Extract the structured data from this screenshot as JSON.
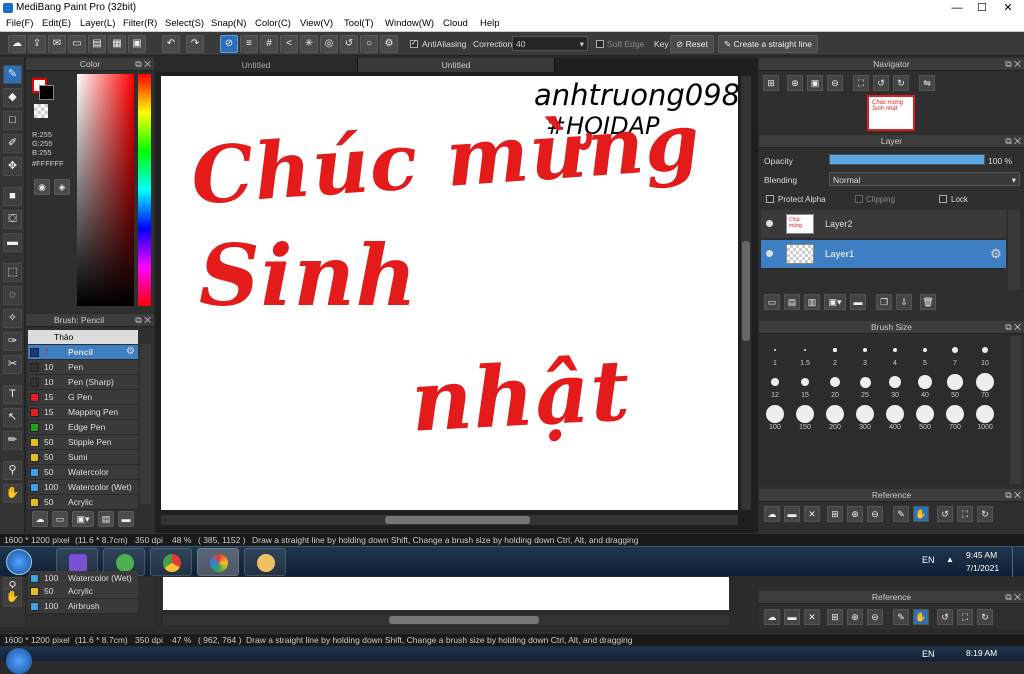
{
  "window": {
    "title": "MediBang Paint Pro (32bit)",
    "minimize": "—",
    "maximize": "☐",
    "close": "✕"
  },
  "menu": [
    "File(F)",
    "Edit(E)",
    "Layer(L)",
    "Filter(R)",
    "Select(S)",
    "Snap(N)",
    "Color(C)",
    "View(V)",
    "Tool(T)",
    "Window(W)",
    "Cloud",
    "Help"
  ],
  "toolbar": {
    "antialiasing": "AntiAliasing",
    "correction_label": "Correction",
    "correction_value": "40",
    "soft_edge": "Soft Edge",
    "key_label": "Key",
    "reset": "Reset",
    "straight_line": "Create a straight line"
  },
  "color_panel": {
    "title": "Color",
    "r": "R:255",
    "g": "G:255",
    "b": "B:255",
    "hex": "#FFFFFF"
  },
  "brush_panel": {
    "title": "Brush: Pencil",
    "group": "Thảo",
    "items": [
      {
        "size": "7",
        "name": "Pencil",
        "color": "#1a3a80"
      },
      {
        "size": "10",
        "name": "Pen",
        "color": "#333333"
      },
      {
        "size": "10",
        "name": "Pen (Sharp)",
        "color": "#333333"
      },
      {
        "size": "15",
        "name": "G Pen",
        "color": "#e02020"
      },
      {
        "size": "15",
        "name": "Mapping Pen",
        "color": "#e02020"
      },
      {
        "size": "10",
        "name": "Edge Pen",
        "color": "#20a020"
      },
      {
        "size": "50",
        "name": "Stipple Pen",
        "color": "#e0c020"
      },
      {
        "size": "50",
        "name": "Sumi",
        "color": "#e0c020"
      },
      {
        "size": "50",
        "name": "Watercolor",
        "color": "#40a0e0"
      },
      {
        "size": "100",
        "name": "Watercolor (Wet)",
        "color": "#40a0e0"
      },
      {
        "size": "50",
        "name": "Acrylic",
        "color": "#e0c020"
      }
    ]
  },
  "tabs": [
    "Untitled",
    "Untitled"
  ],
  "artwork": {
    "line1": "Chúc mừng",
    "line2": "Sinh",
    "line3": "nhật",
    "sig1": "anhtruong098",
    "sig2": "#HOIDAP"
  },
  "navigator": {
    "title": "Navigator"
  },
  "layer_panel": {
    "title": "Layer",
    "opacity_label": "Opacity",
    "opacity_value": "100 %",
    "opacity": 1.0,
    "blending_label": "Blending",
    "blending_value": "Normal",
    "protect_alpha": "Protect Alpha",
    "clipping": "Clipping",
    "lock": "Lock",
    "layers": [
      "Layer2",
      "Layer1"
    ]
  },
  "brush_size": {
    "title": "Brush Size",
    "sizes": [
      "1",
      "1.5",
      "2",
      "3",
      "4",
      "5",
      "7",
      "10",
      "12",
      "15",
      "20",
      "25",
      "30",
      "40",
      "50",
      "70",
      "100",
      "150",
      "200",
      "300",
      "400",
      "500",
      "700",
      "1000"
    ]
  },
  "reference": {
    "title": "Reference"
  },
  "status": {
    "dimensions": "1600 * 1200 pixel",
    "physical": "(11.6 * 8.7cm)",
    "dpi": "350 dpi",
    "zoom": "48 %",
    "coords": "( 385, 1152 )",
    "hint": "Draw a straight line by holding down Shift, Change a brush size by holding down Ctrl, Alt, and dragging"
  },
  "taskbar": {
    "lang": "EN",
    "time": "9:45 AM",
    "date": "7/1/2021"
  },
  "duplicate": {
    "brush_items": [
      {
        "size": "100",
        "name": "Watercolor (Wet)",
        "color": "#40a0e0"
      },
      {
        "size": "50",
        "name": "Acrylic",
        "color": "#e0c020"
      },
      {
        "size": "100",
        "name": "Airbrush",
        "color": "#40a0e0"
      }
    ],
    "reference_title": "Reference",
    "status_dims": "1600 * 1200 pixel",
    "status_phys": "(11.6 * 8.7cm)",
    "status_dpi": "350 dpi",
    "status_zoom": "47 %",
    "status_coords": "( 962, 764 )",
    "status_hint": "Draw a straight line by holding down Shift, Change a brush size by holding down Ctrl, Alt, and dragging",
    "lang": "EN",
    "time": "8:19 AM"
  }
}
